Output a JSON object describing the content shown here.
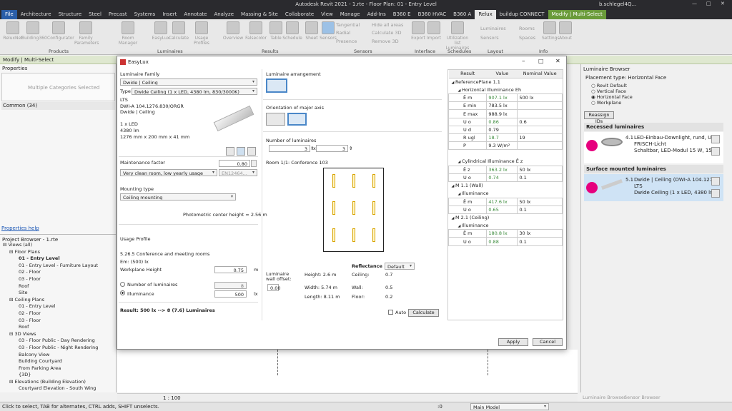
{
  "app": {
    "title": "Autodesk Revit 2021 - 1.rte - Floor Plan: 01 - Entry Level",
    "user": "b.schlegel4Q..."
  },
  "tabs": [
    "File",
    "Architecture",
    "Structure",
    "Steel",
    "Precast",
    "Systems",
    "Insert",
    "Annotate",
    "Analyze",
    "Massing & Site",
    "Collaborate",
    "View",
    "Manage",
    "Add-Ins",
    "B360 E",
    "B360 HVAC",
    "B360 A",
    "Relux",
    "buildup CONNECT",
    "Modify | Multi-Select"
  ],
  "ribbon": {
    "buttons": [
      "ReluxNet",
      "Building360",
      "Configurator",
      "Family Parameters",
      "Room Manager",
      "EasyLux",
      "Calculate",
      "Usage Profiles",
      "Overview",
      "Falsecolor",
      "Table",
      "Schedule",
      "Sheet",
      "Sensors",
      "Export",
      "Import",
      "Utilization list Luminaires"
    ],
    "sensor_items": [
      "Tangential",
      "Radial",
      "Presence",
      "Hide all areas",
      "Calculate 3D",
      "Remove 3D"
    ],
    "layout_items": [
      "Luminaires",
      "Sensors",
      "Rooms",
      "Spaces"
    ],
    "info_items": [
      "Settings",
      "About"
    ],
    "groups": [
      "Products",
      "Luminaires",
      "Results",
      "Sensors",
      "Interface",
      "Schedules",
      "Layout",
      "Info"
    ]
  },
  "modify_bar": "Modify | Multi-Select",
  "properties": {
    "title": "Properties",
    "type": "Multiple Categories Selected",
    "common": "Common (34)",
    "help": "Properties help"
  },
  "browser": {
    "title": "Project Browser - 1.rte",
    "items": [
      {
        "t": "Views (all)",
        "l": 0
      },
      {
        "t": "Floor Plans",
        "l": 1
      },
      {
        "t": "01 - Entry Level",
        "l": 2,
        "b": true
      },
      {
        "t": "01 - Entry Level - Furniture Layout",
        "l": 2
      },
      {
        "t": "02 - Floor",
        "l": 2
      },
      {
        "t": "03 - Floor",
        "l": 2
      },
      {
        "t": "Roof",
        "l": 2
      },
      {
        "t": "Site",
        "l": 2
      },
      {
        "t": "Ceiling Plans",
        "l": 1
      },
      {
        "t": "01 - Entry Level",
        "l": 2
      },
      {
        "t": "02 - Floor",
        "l": 2
      },
      {
        "t": "03 - Floor",
        "l": 2
      },
      {
        "t": "Roof",
        "l": 2
      },
      {
        "t": "3D Views",
        "l": 1
      },
      {
        "t": "03 - Floor Public - Day Rendering",
        "l": 2
      },
      {
        "t": "03 - Floor Public - Night Rendering",
        "l": 2
      },
      {
        "t": "Balcony View",
        "l": 2
      },
      {
        "t": "Building Courtyard",
        "l": 2
      },
      {
        "t": "From Parking Area",
        "l": 2
      },
      {
        "t": "{3D}",
        "l": 2
      },
      {
        "t": "Elevations (Building Elevation)",
        "l": 1
      },
      {
        "t": "Courtyard Elevation - South Wing",
        "l": 2
      }
    ]
  },
  "dialog": {
    "title": "EasyLux",
    "family_label": "Luminaire Family",
    "family_value": "Dwide | Ceiling",
    "type_label": "Type",
    "type_value": "Dwide  Ceiling (1 x LED, 4380 lm, 830/3000K)",
    "info": [
      "LTS",
      "DWI-A 104.1276.830/ORGR",
      "Dwide | Ceiling",
      "",
      "1 x LED",
      "4380 lm",
      "1276 mm x 200 mm x 41 mm"
    ],
    "maintenance_label": "Maintenance factor",
    "maintenance_value": "0.80",
    "maintenance_select": "Very clean room, low yearly usage",
    "maintenance_norm": "EN12464...",
    "mounting_label": "Mounting type",
    "mounting_value": "Ceiling mounting",
    "photometric": "Photometric center height  = 2.56 m",
    "usage_label": "Usage Profile",
    "usage_value": "5.26.5 Conference and meeting rooms",
    "em": "Em: (500) lx",
    "workplane_label": "Workplane Height",
    "workplane_value": "0.75",
    "workplane_unit": "m",
    "num_lum_label": "Number of luminaires",
    "num_lum_value": "8",
    "illum_label": "Illuminance",
    "illum_value": "500",
    "illum_unit": "lx",
    "result": "Result: 500 lx --> 8 (7.6) Luminaires",
    "arrangement_label": "Luminaire arrangement",
    "orientation_label": "Orientation of major axis",
    "number_label": "Number of luminaires",
    "nx": "3",
    "ny": "3",
    "times": "x",
    "room_label": "Room 1/1: Conference 103",
    "wall_offset_label": "Luminaire wall offset:",
    "wall_offset_value": "0.00",
    "height": "Height: 2.6 m",
    "width": "Width:  5.74 m",
    "length": "Length: 8.11 m",
    "reflectance_label": "Reflectance",
    "reflectance_select": "Default",
    "ceiling": "Ceiling:",
    "ceiling_v": "0.7",
    "wall": "Wall:",
    "wall_v": "0.5",
    "floor": "Floor:",
    "floor_v": "0.2",
    "auto": "Auto",
    "calculate": "Calculate",
    "apply": "Apply",
    "cancel": "Cancel",
    "results": {
      "headers": [
        "Result",
        "Value",
        "Nominal Value"
      ],
      "rows": [
        {
          "k": "ReferencePlane 1.1",
          "lvl": 0,
          "hdr": true
        },
        {
          "k": "Horizontal Illuminance Eh",
          "lvl": 1,
          "hdr": true
        },
        {
          "k": "Ē m",
          "v": "907.1 lx",
          "n": "500 lx",
          "g": true,
          "lvl": 2
        },
        {
          "k": "E min",
          "v": "783.5 lx",
          "n": "",
          "lvl": 2
        },
        {
          "k": "E max",
          "v": "988.9 lx",
          "n": "",
          "lvl": 2
        },
        {
          "k": "U o",
          "v": "0.86",
          "n": "0.6",
          "g": true,
          "lvl": 2
        },
        {
          "k": "U d",
          "v": "0.79",
          "n": "",
          "lvl": 2
        },
        {
          "k": "R ugl",
          "v": "18.7",
          "n": "19",
          "g": true,
          "lvl": 2
        },
        {
          "k": "P",
          "v": "9.3 W/m²",
          "n": "",
          "lvl": 2
        },
        {
          "k": "",
          "lvl": -1
        },
        {
          "k": "Cylindrical Illuminance Ē z",
          "lvl": 1,
          "hdr": true
        },
        {
          "k": "Ē z",
          "v": "363.2 lx",
          "n": "50 lx",
          "g": true,
          "lvl": 2
        },
        {
          "k": "U o",
          "v": "0.74",
          "n": "0.1",
          "g": true,
          "lvl": 2
        },
        {
          "k": "M 1.1 (Wall)",
          "lvl": 0,
          "hdr": true
        },
        {
          "k": "Illuminance",
          "lvl": 1,
          "hdr": true
        },
        {
          "k": "Ē m",
          "v": "417.6 lx",
          "n": "50 lx",
          "g": true,
          "lvl": 2
        },
        {
          "k": "U o",
          "v": "0.65",
          "n": "0.1",
          "g": true,
          "lvl": 2
        },
        {
          "k": "M 2.1 (Ceiling)",
          "lvl": 0,
          "hdr": true
        },
        {
          "k": "Illuminance",
          "lvl": 1,
          "hdr": true
        },
        {
          "k": "Ē m",
          "v": "180.8 lx",
          "n": "30 lx",
          "g": true,
          "lvl": 2
        },
        {
          "k": "U o",
          "v": "0.88",
          "n": "0.1",
          "g": true,
          "lvl": 2
        }
      ]
    }
  },
  "lum_browser": {
    "title": "Luminaire Browser",
    "placement": "Placement type: Horizontal Face",
    "options": [
      "Revit Default",
      "Vertical Face",
      "Horizontal Face",
      "Workplane"
    ],
    "selected": 2,
    "reassign": "Reassign IDs",
    "recessed": "Recessed luminaires",
    "rec_num": "4.1",
    "rec_name": "LED-Einbau-Downlight, rund, UG",
    "rec_l2": "FRISCH-Licht",
    "rec_l3": "Schaltbar, LED-Modul 15 W, 150(",
    "surface": "Surface mounted luminaires",
    "sur_num": "5.1",
    "sur_name": "Dwide | Ceiling (DWI-A 104.1276",
    "sur_l2": "LTS",
    "sur_l3": "Dwide  Ceiling (1 x LED, 4380 lm",
    "tabs": [
      "Luminaire Browser",
      "Sensor Browser"
    ]
  },
  "status": {
    "left": "Click to select, TAB for alternates, CTRL adds, SHIFT unselects.",
    "scale": "1 : 100",
    "model": "Main Model",
    "zero": ":0"
  }
}
